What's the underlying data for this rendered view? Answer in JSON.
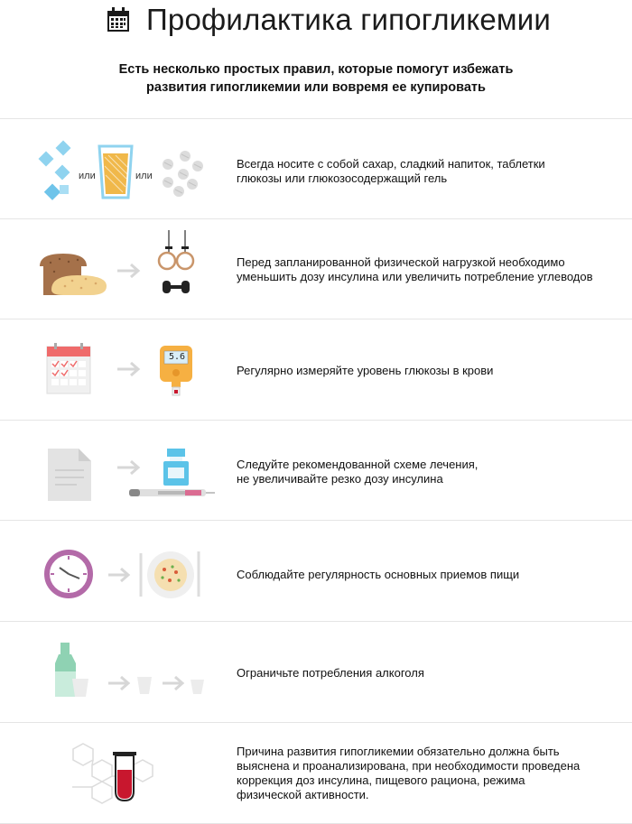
{
  "header": {
    "title": "Профилактика гипогликемии",
    "subtitle_lines": [
      "Есть несколько простых правил, которые помогут избежать",
      "развития гипогликемии или вовремя ее купировать"
    ]
  },
  "rows": [
    {
      "icons": [
        "sugar-cubes-icon",
        "juice-glass-icon",
        "glucose-tablets-icon"
      ],
      "or_label_1": "или",
      "or_label_2": "или",
      "lines": [
        "Всегда носите с собой сахар, сладкий напиток, таблетки",
        "глюкозы или глюкозосодержащий гель"
      ]
    },
    {
      "icons": [
        "bread-icon",
        "arrow-icon",
        "gymnastic-rings-icon",
        "dumbbell-icon"
      ],
      "lines": [
        "Перед запланированной физической нагрузкой необходимо",
        "уменьшить дозу инсулина или увеличить потребление углеводов"
      ]
    },
    {
      "icons": [
        "calendar-icon",
        "arrow-icon",
        "glucometer-icon"
      ],
      "glucometer_value": "5.6",
      "lines": [
        "Регулярно измеряйте уровень глюкозы в крови"
      ]
    },
    {
      "icons": [
        "document-icon",
        "arrow-icon",
        "insulin-vial-icon",
        "insulin-pen-icon"
      ],
      "lines": [
        "Следуйте рекомендованной схеме лечения,",
        "не увеличивайте резко дозу инсулина"
      ]
    },
    {
      "icons": [
        "clock-icon",
        "arrow-icon",
        "plate-icon"
      ],
      "lines": [
        "Соблюдайте регулярность основных приемов пищи"
      ]
    },
    {
      "icons": [
        "bottle-icon",
        "arrow-icon",
        "glass-icon"
      ],
      "lines": [
        "Ограничьте потребления алкоголя"
      ]
    },
    {
      "icons": [
        "molecule-icon",
        "test-tube-icon"
      ],
      "lines": [
        "Причина развития гипогликемии обязательно должна быть",
        "выяснена и проанализирована, при необходимости проведена",
        "коррекция доз инсулина, пищевого рациона, режима",
        "физической активности."
      ]
    }
  ],
  "colors": {
    "ice": "#8fd3ef",
    "juice": "#f0b84a",
    "pill": "#dcdcdc",
    "bread": "#a5714a",
    "bread_light": "#f2d28f",
    "calendar_red": "#ef6b6b",
    "meter_orange": "#f6b042",
    "vial_blue": "#5bc3e8",
    "clock_purple": "#b36aa8",
    "bottle_green": "#8fd2b3",
    "tube_red": "#c8172e",
    "arrow": "#d7d7d7",
    "divider": "#e5e5e5"
  }
}
